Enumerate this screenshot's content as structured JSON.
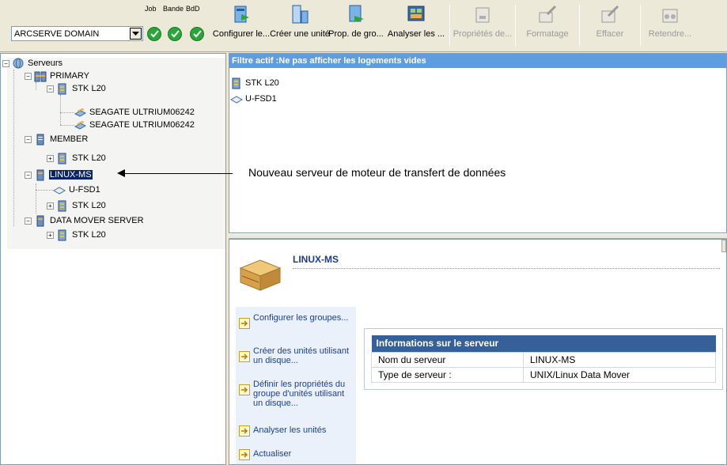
{
  "status": {
    "labels": [
      "Job",
      "Bande",
      "BdD"
    ],
    "domain_value": "ARCSERVE DOMAIN",
    "ok_color": "#2aa53a"
  },
  "toolbar": {
    "buttons": [
      {
        "label": "Configurer le...",
        "icon": "configure-group-icon",
        "enabled": true
      },
      {
        "label": "Créer une unité",
        "icon": "create-unit-icon",
        "enabled": true
      },
      {
        "label": "Prop. de gro...",
        "icon": "group-properties-icon",
        "enabled": true
      },
      {
        "label": "Analyser les ...",
        "icon": "analyze-icon",
        "enabled": true
      },
      {
        "label": "Propriétés de...",
        "icon": "properties-icon",
        "enabled": false
      },
      {
        "label": "Formatage",
        "icon": "format-icon",
        "enabled": false
      },
      {
        "label": "Effacer",
        "icon": "erase-icon",
        "enabled": false
      },
      {
        "label": "Retendre...",
        "icon": "retension-icon",
        "enabled": false
      }
    ]
  },
  "tree": {
    "root": "Serveurs",
    "primary": "PRIMARY",
    "primary_lib": "STK L20",
    "drive1": "SEAGATE ULTRIUM06242",
    "drive2": "SEAGATE ULTRIUM06242",
    "member": "MEMBER",
    "member_lib": "STK L20",
    "linux": "LINUX-MS",
    "linux_fsd": "U-FSD1",
    "linux_lib": "STK L20",
    "dms": "DATA MOVER SERVER",
    "dms_lib": "STK L20"
  },
  "filter": {
    "bar": "Filtre actif :Ne pas afficher les logements vides",
    "items": [
      "STK L20",
      "U-FSD1"
    ]
  },
  "annotation": {
    "text": "Nouveau serveur de moteur de transfert de données"
  },
  "detail": {
    "server_name": "LINUX-MS",
    "actions": [
      "Configurer les groupes...",
      "Créer des unités utilisant un disque...",
      "Définir les propriétés du groupe d'unités utilisant un disque...",
      "Analyser les unités",
      "Actualiser"
    ],
    "info": {
      "header": "Informations sur le serveur",
      "rows": [
        {
          "key": "Nom du serveur",
          "value": "LINUX-MS"
        },
        {
          "key": "Type de serveur :",
          "value": "UNIX/Linux Data Mover"
        }
      ]
    }
  }
}
